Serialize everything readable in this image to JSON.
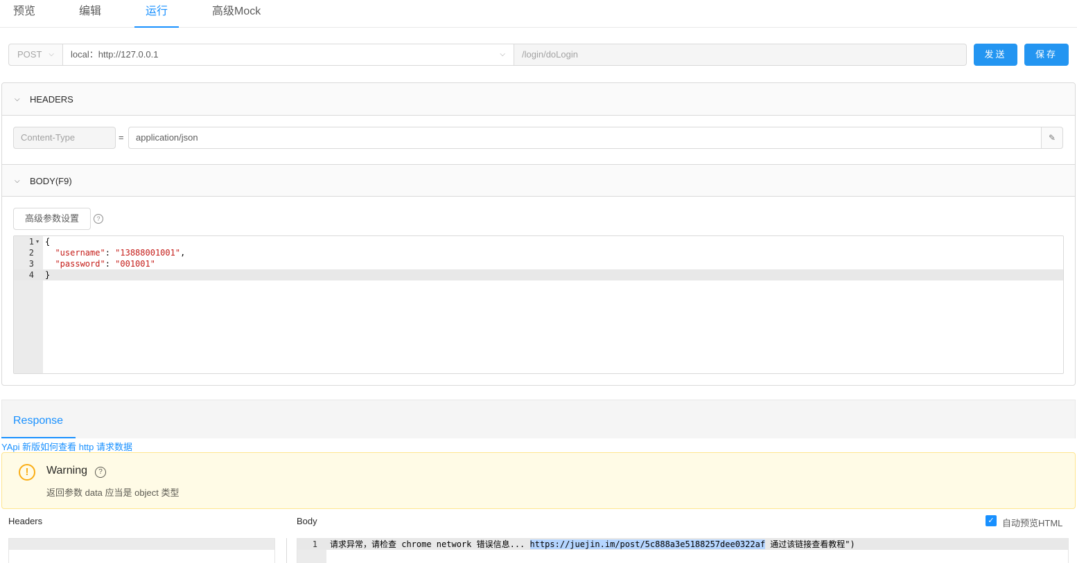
{
  "tabs": [
    {
      "label": "预览"
    },
    {
      "label": "编辑"
    },
    {
      "label": "运行"
    },
    {
      "label": "高级Mock"
    }
  ],
  "request": {
    "method": "POST",
    "environment": "local：http://127.0.0.1",
    "path": "/login/doLogin",
    "send_label": "发送",
    "save_label": "保存"
  },
  "headers_panel": {
    "title": "HEADERS",
    "header_key": "Content-Type",
    "equals": "=",
    "header_value": "application/json"
  },
  "body_panel": {
    "title": "BODY(F9)",
    "advanced_label": "高级参数设置",
    "code": {
      "l1": "{",
      "l2_key": "\"username\"",
      "l2_val": "\"13888001001\"",
      "l3_key": "\"password\"",
      "l3_val": "\"001001\"",
      "l4": "}"
    },
    "line_numbers": [
      "1",
      "2",
      "3",
      "4"
    ]
  },
  "response": {
    "tab_label": "Response",
    "help_link": "YApi 新版如何查看 http 请求数据",
    "warning_title": "Warning",
    "warning_desc": "返回参数 data 应当是 object 类型",
    "headers_label": "Headers",
    "body_label": "Body",
    "auto_preview_label": "自动预览HTML",
    "auto_preview_checked": true,
    "body_line_number": "1",
    "body_text_before": "请求异常，请检查 chrome network 错误信息... ",
    "body_link": "https://juejin.im/post/5c888a3e5188257dee0322af",
    "body_text_after": " 通过该链接查看教程\")"
  },
  "colors": {
    "accent": "#1890ff",
    "button": "#2395f1",
    "warning_bg": "#fffbe6",
    "warning_icon": "#faad14",
    "string": "#c41a16"
  }
}
